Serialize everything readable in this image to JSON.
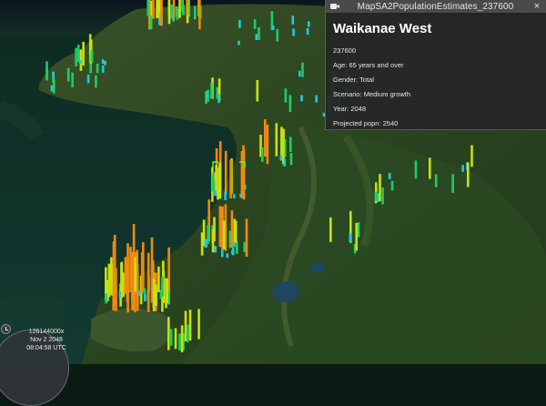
{
  "infobox": {
    "title": "MapSA2PopulationEstimates_237600",
    "close_label": "×",
    "heading": "Waikanae West",
    "lines": [
      "237600",
      "Age: 65 years and over",
      "Gender: Total",
      "Scenario: Medium growth",
      "Year: 2048",
      "Projected popn: 2540"
    ]
  },
  "clock": {
    "multiplier": "126144000x",
    "date": "Nov 2 2048",
    "time": "08:04:58 UTC"
  },
  "colors": {
    "infobox_bg": "#262626",
    "bar_high": "#f08a10",
    "bar_mid": "#c8e010",
    "bar_low": "#18d060",
    "bar_min": "#20c8e0",
    "selection": "#4cff4c"
  },
  "icons": {
    "infobox_camera": "camera-icon",
    "infobox_close": "close-icon",
    "animation": "stopwatch-icon"
  }
}
